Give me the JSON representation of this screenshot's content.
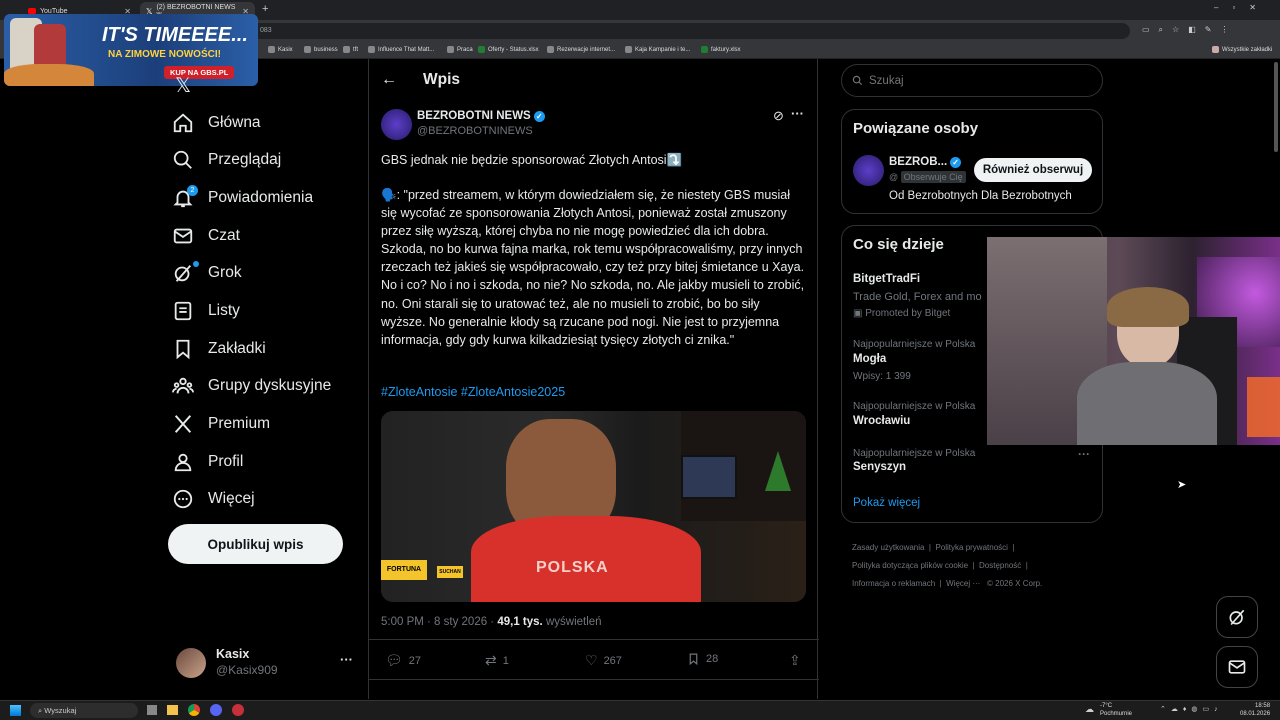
{
  "browser": {
    "tabs": [
      {
        "title": "YouTube"
      },
      {
        "title": "(2) BEZROBOTNI NEWS w..."
      }
    ],
    "url_fragment": "083",
    "bookmarks": [
      "Kasix",
      "business",
      "tft",
      "Influence That Matt...",
      "Praca",
      "Oferty - Status.xlsx",
      "Rezerwacje internet...",
      "Kaja Kampanie i te...",
      "faktury.xlsx"
    ],
    "all_bookmarks": "Wszystkie zakładki"
  },
  "ad": {
    "headline": "IT'S TIMEEEE...",
    "subline": "NA ZIMOWE NOWOŚCI!",
    "cta": "KUP NA GBS.PL"
  },
  "nav": {
    "items": [
      {
        "label": "Główna",
        "icon": "home-icon"
      },
      {
        "label": "Przeglądaj",
        "icon": "search-icon"
      },
      {
        "label": "Powiadomienia",
        "icon": "bell-icon",
        "badge": "2"
      },
      {
        "label": "Czat",
        "icon": "mail-icon"
      },
      {
        "label": "Grok",
        "icon": "grok-icon"
      },
      {
        "label": "Listy",
        "icon": "list-icon"
      },
      {
        "label": "Zakładki",
        "icon": "bookmark-icon"
      },
      {
        "label": "Grupy dyskusyjne",
        "icon": "communities-icon"
      },
      {
        "label": "Premium",
        "icon": "x-logo-icon"
      },
      {
        "label": "Profil",
        "icon": "profile-icon"
      },
      {
        "label": "Więcej",
        "icon": "more-circle-icon"
      }
    ],
    "publish": "Opublikuj wpis",
    "account": {
      "name": "Kasix",
      "handle": "@Kasix909"
    }
  },
  "post": {
    "header": "Wpis",
    "author": "BEZROBOTNI NEWS",
    "handle": "@BEZROBOTNINEWS",
    "first_line": "GBS jednak nie będzie sponsorować Złotych Antosi⤵️",
    "quote": "🗣️: \"przed streamem, w którym dowiedziałem się, że niestety GBS musiał się wycofać ze sponsorowania Złotych Antosi, ponieważ został zmuszony przez siłę wyższą, której chyba no nie mogę powiedzieć dla ich dobra. Szkoda, no bo kurwa fajna marka, rok temu współpracowaliśmy, przy innych rzeczach też jakieś się współpracowało, czy też przy bitej śmietance u Xaya. No i co? No i no i szkoda, no nie? No szkoda, no. Ale jakby musieli to zrobić, no. Oni starali się to uratować też, ale no musieli to zrobić, bo bo siły wyższe. No generalnie kłody są rzucane pod nogi. Nie jest to przyjemna informacja, gdy gdy kurwa kilkadziesiąt tysięcy złotych ci znika.\"",
    "hashtags": "#ZloteAntosie #ZloteAntosie2025",
    "video": {
      "sign_left": "FORTUNA",
      "sign_right": "SUCHAN",
      "shirt": "POLSKA"
    },
    "time": "5:00 PM · 8 sty 2026 · ",
    "views": "49,1 tys.",
    "views_label": "wyświetleń",
    "stats": {
      "replies": "27",
      "reposts": "1",
      "likes": "267",
      "bookmarks": "28"
    }
  },
  "right": {
    "search_placeholder": "Szukaj",
    "related_title": "Powiązane osoby",
    "related": {
      "name": "BEZROB...",
      "follows_you": "Obserwuje Cię",
      "button": "Również obserwuj",
      "bio": "Od Bezrobotnych Dla Bezrobotnych"
    },
    "trends_title": "Co się dzieje",
    "promo": {
      "name": "BitgetTradFi",
      "desc": "Trade Gold, Forex and mo",
      "promoted": "Promoted by Bitget"
    },
    "trends": [
      {
        "context": "Najpopularniejsze w Polska",
        "name": "Mogła",
        "count": "Wpisy: 1 399"
      },
      {
        "context": "Najpopularniejsze w Polska",
        "name": "Wrocławiu",
        "count": ""
      },
      {
        "context": "Najpopularniejsze w Polska",
        "name": "Senyszyn",
        "count": ""
      }
    ],
    "show_more": "Pokaż więcej",
    "footer": [
      "Zasady użytkowania",
      "Polityka prywatności",
      "Polityka dotycząca plików cookie",
      "Dostępność",
      "Informacja o reklamach",
      "Więcej ···",
      "© 2026 X Corp."
    ]
  },
  "taskbar": {
    "search": "Wyszukaj",
    "weather_temp": "-7°C",
    "weather_desc": "Pochmurnie",
    "time": "18:58",
    "date": "08.01.2026"
  },
  "colors": {
    "accent": "#1d9bf0",
    "bg": "#000000",
    "border": "#2f3336",
    "muted": "#71767b"
  }
}
